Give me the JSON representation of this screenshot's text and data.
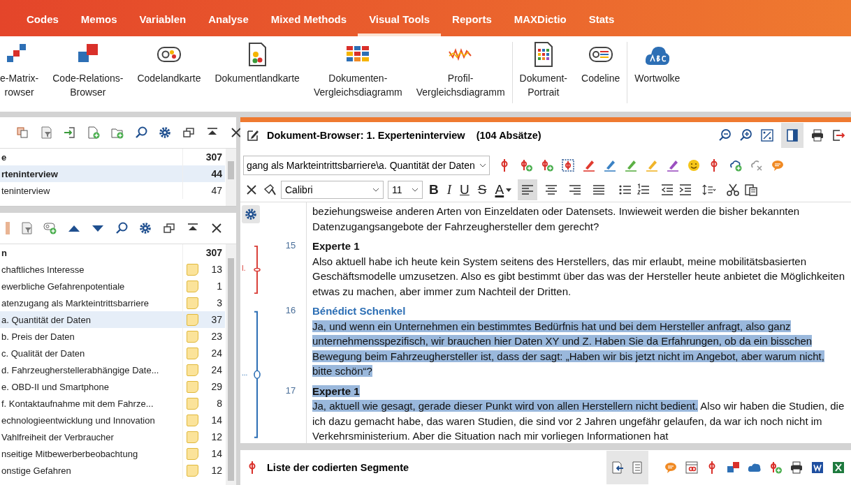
{
  "menu": {
    "tabs": [
      {
        "label": "Codes",
        "selected": false
      },
      {
        "label": "Memos",
        "selected": false
      },
      {
        "label": "Variablen",
        "selected": false
      },
      {
        "label": "Analyse",
        "selected": false
      },
      {
        "label": "Mixed Methods",
        "selected": false
      },
      {
        "label": "Visual Tools",
        "selected": true
      },
      {
        "label": "Reports",
        "selected": false
      },
      {
        "label": "MAXDictio",
        "selected": false
      },
      {
        "label": "Stats",
        "selected": false
      }
    ]
  },
  "ribbon": {
    "items": [
      {
        "kind": "matrix",
        "label": "e-Matrix-\nrowser",
        "separator_before": false
      },
      {
        "kind": "relations",
        "label": "Code-Relations-\nBrowser",
        "separator_before": false
      },
      {
        "kind": "codemap",
        "label": "Codelandkarte",
        "separator_before": false
      },
      {
        "kind": "docmap",
        "label": "Dokumentlandkarte",
        "separator_before": false
      },
      {
        "kind": "grid",
        "label": "Dokumenten-\nVergleichsdiagramm",
        "separator_before": false
      },
      {
        "kind": "zigzag",
        "label": "Profil-\nVergleichsdiagramm",
        "separator_before": false
      },
      {
        "kind": "portrait",
        "label": "Dokument-\nPortrait",
        "separator_before": true
      },
      {
        "kind": "codeline",
        "label": "Codeline",
        "separator_before": false
      },
      {
        "kind": "cloud",
        "label": "Wortwolke",
        "separator_before": true
      }
    ]
  },
  "documents": {
    "header": {
      "name": "e",
      "count": "307"
    },
    "rows": [
      {
        "name": "rteninterview",
        "count": "44",
        "selected": true
      },
      {
        "name": "teninterview",
        "count": "47",
        "selected": false
      }
    ]
  },
  "codes": {
    "header": {
      "name": "n",
      "count": "307"
    },
    "rows": [
      {
        "name": "chaftliches Interesse",
        "count": "13",
        "selected": false
      },
      {
        "name": "ewerbliche Gefahrenpotentiale",
        "count": "1",
        "selected": false
      },
      {
        "name": "atenzugang als Markteintrittsbarriere",
        "count": "3",
        "selected": false
      },
      {
        "name": "a. Quantität der Daten",
        "count": "37",
        "selected": true
      },
      {
        "name": "b. Preis der Daten",
        "count": "23",
        "selected": false
      },
      {
        "name": "c. Qualität der Daten",
        "count": "24",
        "selected": false
      },
      {
        "name": "d. Fahrzeugherstellerabhängige Date...",
        "count": "24",
        "selected": false
      },
      {
        "name": "e. OBD-II und Smartphone",
        "count": "29",
        "selected": false
      },
      {
        "name": "f. Kontaktaufnahme mit dem Fahrze...",
        "count": "8",
        "selected": false
      },
      {
        "name": "echnologieentwicklung und Innovation",
        "count": "14",
        "selected": false
      },
      {
        "name": "Vahlfreiheit der Verbraucher",
        "count": "12",
        "selected": false
      },
      {
        "name": "nseitige Mitbewerberbeobachtung",
        "count": "14",
        "selected": false
      },
      {
        "name": "onstige Gefahren",
        "count": "12",
        "selected": false
      }
    ]
  },
  "document_browser": {
    "title": "Dokument-Browser: 1. Experteninterview",
    "paragraph_count": "(104 Absätze)",
    "code_path": "gang als Markteintrittsbarriere\\a. Quantität der Daten",
    "font": "Calibri",
    "font_size": "11",
    "style_buttons": [
      {
        "kind": "bold",
        "label": "B"
      },
      {
        "kind": "italic",
        "label": "I"
      },
      {
        "kind": "underline",
        "label": "U"
      },
      {
        "kind": "strike",
        "label": "S"
      },
      {
        "kind": "color",
        "label": "A"
      }
    ],
    "alignments": [
      {
        "kind": "left",
        "selected": true
      },
      {
        "kind": "center",
        "selected": false
      },
      {
        "kind": "right",
        "selected": false
      },
      {
        "kind": "justify",
        "selected": false
      }
    ],
    "segments": [
      {
        "paragraphs": [
          {
            "parts": [
              {
                "text": "beziehungsweise anderen Arten von Einzeldaten oder Datensets. Inwieweit werden die bisher bekannten Datenzugangsangebote der Fahrzeughersteller dem gerecht?",
                "highlighted": false
              }
            ]
          }
        ]
      },
      {
        "stripe": {
          "color": "#d9403a",
          "label": "I."
        },
        "paragraphs": [
          {
            "number": "15",
            "speaker": {
              "text": "Experte 1",
              "kind": "respondent",
              "highlighted": false
            },
            "parts": [
              {
                "text": "Also aktuell habe ich heute kein System seitens des Herstellers, das mir erlaubt, meine mobilitätsbasierten Geschäftsmodelle umzusetzen. Also es gibt bestimmt über das was der Hersteller heute anbietet die Möglichkeiten etwas zu machen, aber immer zum Nachteil der Dritten.",
                "highlighted": false
              }
            ]
          }
        ]
      },
      {
        "stripe": {
          "color": "#2d6fb5",
          "label": "..."
        },
        "paragraphs": [
          {
            "number": "16",
            "speaker": {
              "text": "Bénédict Schenkel",
              "kind": "interviewer",
              "highlighted": false
            },
            "parts": [
              {
                "text": "Ja, und wenn ein Unternehmen ein bestimmtes Bedürfnis hat und bei dem Hersteller anfragt, also ganz unternehmensspezifisch, wir brauchen hier Daten XY und Z. Haben Sie da Erfahrungen, ob da ein bisschen Bewegung beim Fahrzeughersteller ist, dass der sagt: „Haben wir bis jetzt nicht im Angebot, aber warum nicht, bitte schön“?",
                "highlighted": true
              }
            ]
          },
          {
            "number": "17",
            "speaker": {
              "text": "Experte 1",
              "kind": "respondent",
              "highlighted": true
            },
            "parts": [
              {
                "text": "Ja, aktuell wie gesagt, gerade dieser Punkt wird von allen Herstellern nicht bedient.",
                "highlighted": true
              },
              {
                "text": " Also wir haben die Studien, die ich dazu gemacht habe, das waren Studien, die sind vor 2 Jahren ungefähr gelaufen, da war ich noch nicht im Verkehrsministerium. Aber die Situation nach mir vorliegen Informationen hat",
                "highlighted": false
              }
            ]
          }
        ]
      }
    ]
  },
  "segment_list": {
    "title": "Liste der codierten Segmente"
  }
}
